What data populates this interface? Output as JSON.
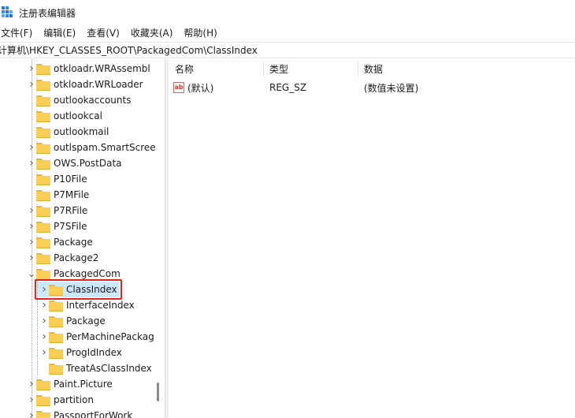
{
  "window": {
    "title": "注册表编辑器"
  },
  "menu": [
    "文件(F)",
    "编辑(E)",
    "查看(V)",
    "收藏夹(A)",
    "帮助(H)"
  ],
  "address": "计算机\\HKEY_CLASSES_ROOT\\PackagedCom\\ClassIndex",
  "tree": [
    {
      "label": "otkloadr.WRAssembl",
      "expandable": true
    },
    {
      "label": "otkloadr.WRLoader",
      "expandable": true
    },
    {
      "label": "outlookaccounts",
      "expandable": false
    },
    {
      "label": "outlookcal",
      "expandable": false
    },
    {
      "label": "outlookmail",
      "expandable": false
    },
    {
      "label": "outlspam.SmartScree",
      "expandable": true
    },
    {
      "label": "OWS.PostData",
      "expandable": true
    },
    {
      "label": "P10File",
      "expandable": false
    },
    {
      "label": "P7MFile",
      "expandable": false
    },
    {
      "label": "P7RFile",
      "expandable": true
    },
    {
      "label": "P7SFile",
      "expandable": true
    },
    {
      "label": "Package",
      "expandable": true
    },
    {
      "label": "Package2",
      "expandable": true
    },
    {
      "label": "PackagedCom",
      "expandable": true,
      "expanded": true
    },
    {
      "label": "ClassIndex",
      "expandable": true,
      "child": true,
      "selected": true
    },
    {
      "label": "InterfaceIndex",
      "expandable": true,
      "child": true
    },
    {
      "label": "Package",
      "expandable": true,
      "child": true
    },
    {
      "label": "PerMachinePackag",
      "expandable": true,
      "child": true
    },
    {
      "label": "ProgIdIndex",
      "expandable": true,
      "child": true
    },
    {
      "label": "TreatAsClassIndex",
      "expandable": false,
      "child": true
    },
    {
      "label": "Paint.Picture",
      "expandable": true
    },
    {
      "label": "partition",
      "expandable": true
    },
    {
      "label": "PassportForWork",
      "expandable": true
    }
  ],
  "columns": {
    "name": "名称",
    "type": "类型",
    "data": "数据"
  },
  "values": [
    {
      "name": "(默认)",
      "type": "REG_SZ",
      "data": "(数值未设置)",
      "icon": "ab"
    }
  ]
}
